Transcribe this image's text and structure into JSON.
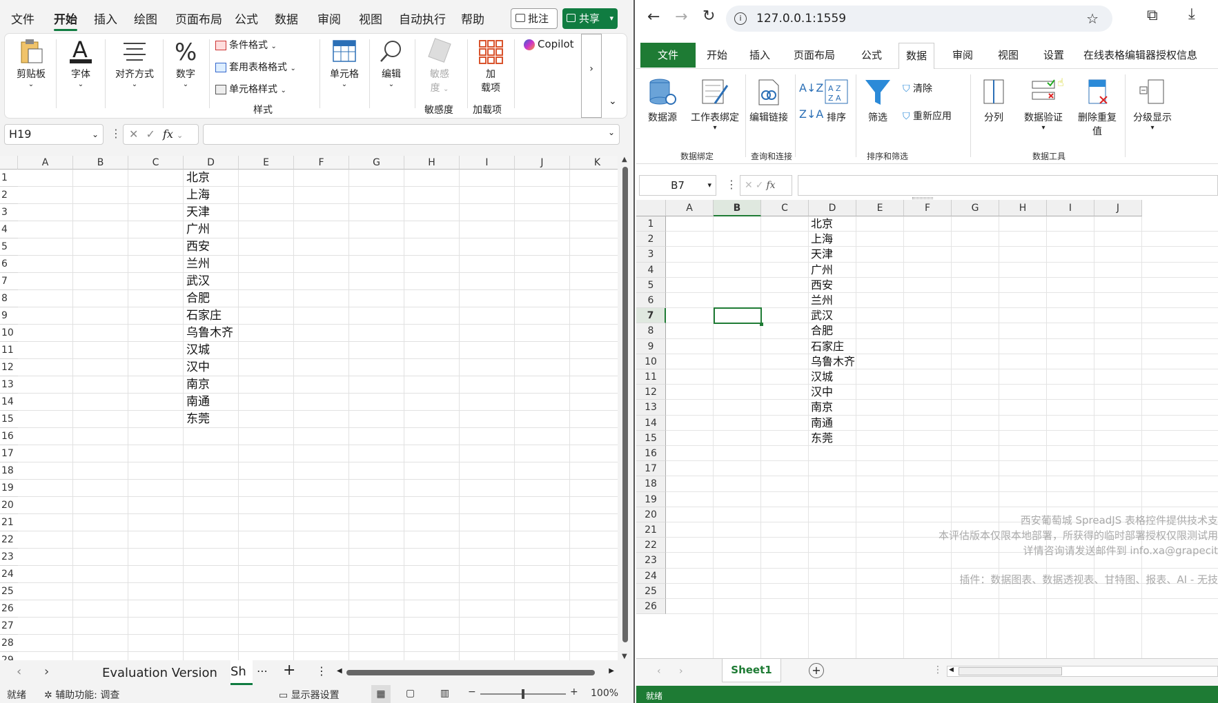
{
  "excel": {
    "menu_tabs": [
      "文件",
      "开始",
      "插入",
      "绘图",
      "页面布局",
      "公式",
      "数据",
      "审阅",
      "视图",
      "自动执行",
      "帮助"
    ],
    "comment_button": "批注",
    "share_button": "共享",
    "ribbon": {
      "clipboard": "剪贴板",
      "font": "字体",
      "align": "对齐方式",
      "number": "数字",
      "conditional_format": "条件格式",
      "table_format": "套用表格格式",
      "cell_style": "单元格样式",
      "styles_group": "样式",
      "cells": "单元格",
      "edit": "编辑",
      "sensitivity_line1": "敏感",
      "sensitivity_line2": "度",
      "sensitivity_group": "敏感度",
      "addin_line1": "加",
      "addin_line2": "载项",
      "addin_group": "加载项",
      "copilot": "Copilot"
    },
    "name_box": "H19",
    "fx": "fx",
    "columns": [
      "A",
      "B",
      "C",
      "D",
      "E",
      "F",
      "G",
      "H",
      "I",
      "J",
      "K"
    ],
    "rows": [
      "1",
      "2",
      "3",
      "4",
      "5",
      "6",
      "7",
      "8",
      "9",
      "10",
      "11",
      "12",
      "13",
      "14",
      "15",
      "16",
      "17",
      "18",
      "19",
      "20",
      "21",
      "22",
      "23",
      "24",
      "25",
      "26",
      "27",
      "28",
      "29"
    ],
    "column_d_values": [
      "北京",
      "上海",
      "天津",
      "广州",
      "西安",
      "兰州",
      "武汉",
      "合肥",
      "石家庄",
      "乌鲁木齐",
      "汉城",
      "汉中",
      "南京",
      "南通",
      "东莞"
    ],
    "sheet_tabs": [
      "Evaluation Version",
      "Sh"
    ],
    "status": {
      "ready": "就绪",
      "accessibility": "辅助功能: 调查",
      "display_settings": "显示器设置",
      "zoom": "100%"
    }
  },
  "browser": {
    "url": "127.0.0.1:1559",
    "tabs": [
      "文件",
      "开始",
      "插入",
      "页面布局",
      "公式",
      "数据",
      "审阅",
      "视图",
      "设置",
      "在线表格编辑器授权信息"
    ],
    "ribbon": {
      "data_source": "数据源",
      "sheet_binding": "工作表绑定",
      "edit_links": "编辑链接",
      "sort": "排序",
      "filter": "筛选",
      "clear": "清除",
      "reapply": "重新应用",
      "split": "分列",
      "data_validation": "数据验证",
      "remove_dup_line1": "删除重复",
      "remove_dup_line2": "值",
      "outline": "分级显示",
      "group_binding": "数据绑定",
      "group_query": "查询和连接",
      "group_sort": "排序和筛选",
      "group_tools": "数据工具"
    },
    "name_box": "B7",
    "fx": "fx",
    "columns": [
      "A",
      "B",
      "C",
      "D",
      "E",
      "F",
      "G",
      "H",
      "I",
      "J"
    ],
    "rows": [
      "1",
      "2",
      "3",
      "4",
      "5",
      "6",
      "7",
      "8",
      "9",
      "10",
      "11",
      "12",
      "13",
      "14",
      "15",
      "16",
      "17",
      "18",
      "19",
      "20",
      "21",
      "22",
      "23",
      "24",
      "25",
      "26"
    ],
    "column_d_values": [
      "北京",
      "上海",
      "天津",
      "广州",
      "西安",
      "兰州",
      "武汉",
      "合肥",
      "石家庄",
      "乌鲁木齐",
      "汉城",
      "汉中",
      "南京",
      "南通",
      "东莞"
    ],
    "watermark": [
      "西安葡萄城 SpreadJS 表格控件提供技术支",
      "本评估版本仅限本地部署，所获得的临时部署授权仅限测试用",
      "详情咨询请发送邮件到 info.xa@grapecit",
      "插件：数据图表、数据透视表、甘特图、报表、AI - 无技"
    ],
    "sheet_tab": "Sheet1",
    "status": "就绪"
  }
}
